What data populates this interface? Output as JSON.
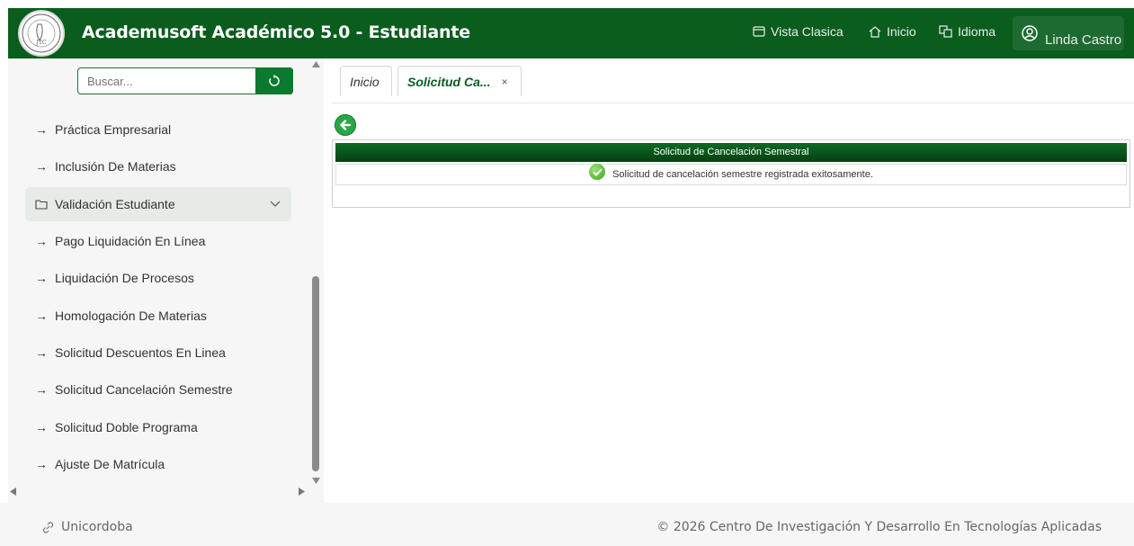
{
  "header": {
    "title": "Academusoft Académico 5.0 - Estudiante",
    "links": [
      {
        "label": "Vista Clasica",
        "icon": "window-icon"
      },
      {
        "label": "Inicio",
        "icon": "home-icon"
      },
      {
        "label": "Idioma",
        "icon": "language-icon"
      }
    ],
    "user": {
      "name": "Linda Castro",
      "icon": "user-circle-icon"
    },
    "color": "#0b5d1e"
  },
  "sidebar": {
    "search": {
      "placeholder": "Buscar...",
      "button_icon": "refresh-icon"
    },
    "items": [
      {
        "label": "Práctica Empresarial"
      },
      {
        "label": "Inclusión De Materias"
      },
      {
        "label": "Validación Estudiante"
      },
      {
        "label": "Pago Liquidación En Línea"
      },
      {
        "label": "Liquidación De Procesos"
      },
      {
        "label": "Homologación De Materias"
      },
      {
        "label": "Solicitud Descuentos En Linea"
      },
      {
        "label": "Solicitud Cancelación Semestre"
      },
      {
        "label": "Solicitud Doble Programa"
      },
      {
        "label": "Ajuste De Matrícula"
      }
    ]
  },
  "tabs": [
    {
      "label": "Inicio"
    },
    {
      "label": "Solicitud Ca...",
      "close": "×"
    }
  ],
  "panel": {
    "title": "Solicitud de Cancelación Semestral",
    "message": "Solicitud de cancelación semestre registrada exitosamente."
  },
  "footer": {
    "left": "Unicordoba",
    "right": "© 2026 Centro De Investigación Y Desarrollo En Tecnologías Aplicadas"
  }
}
